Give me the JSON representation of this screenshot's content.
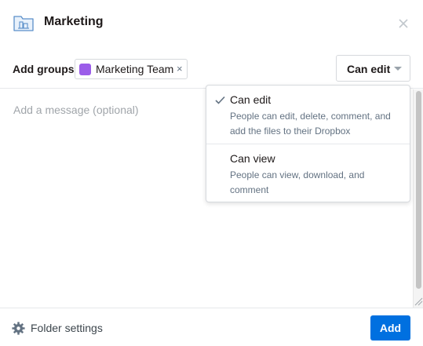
{
  "header": {
    "title": "Marketing",
    "folder_icon": "shared-folder-icon",
    "close_icon": "close-icon"
  },
  "groups": {
    "label": "Add groups:",
    "chips": [
      {
        "label": "Marketing Team",
        "color": "#9b5ce9",
        "remove": "×"
      }
    ]
  },
  "permission": {
    "selected": "Can edit",
    "options": [
      {
        "title": "Can edit",
        "description": "People can edit, delete, comment, and add the files to their Dropbox",
        "checked": true
      },
      {
        "title": "Can view",
        "description": "People can view, download, and comment",
        "checked": false
      }
    ]
  },
  "message": {
    "placeholder": "Add a message (optional)",
    "value": ""
  },
  "footer": {
    "settings_label": "Folder settings",
    "settings_icon": "gear-icon",
    "add_label": "Add"
  },
  "colors": {
    "primary": "#0070e0",
    "chip_swatch": "#9b5ce9",
    "muted_text": "#637282"
  }
}
